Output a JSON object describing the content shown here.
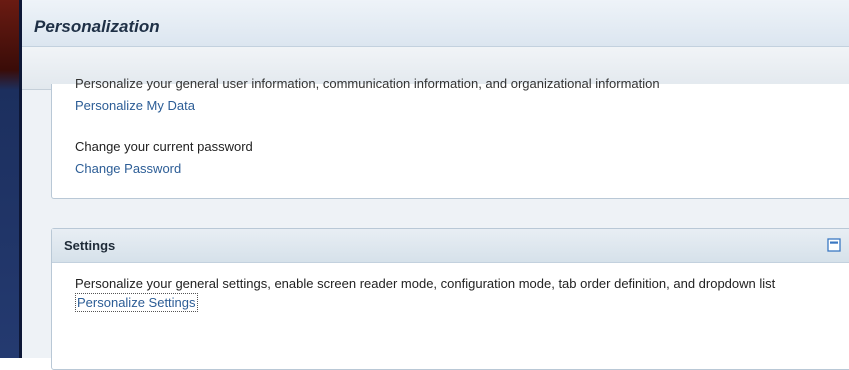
{
  "header": {
    "title": "Personalization"
  },
  "my_data": {
    "description": "Personalize your general user information, communication information, and organizational information",
    "link": "Personalize My Data"
  },
  "password": {
    "description": "Change your current password",
    "link": "Change Password"
  },
  "settings_panel": {
    "title": "Settings",
    "description": "Personalize your general settings, enable screen reader mode, configuration mode, tab order definition, and dropdown list",
    "link": "Personalize Settings",
    "icons": [
      "minimize-icon",
      "close-icon"
    ]
  },
  "colors": {
    "link": "#2c5d96",
    "title_text": "#1f3046",
    "panel_border": "#b9c8d6",
    "close_icon": "#3b78c2"
  }
}
